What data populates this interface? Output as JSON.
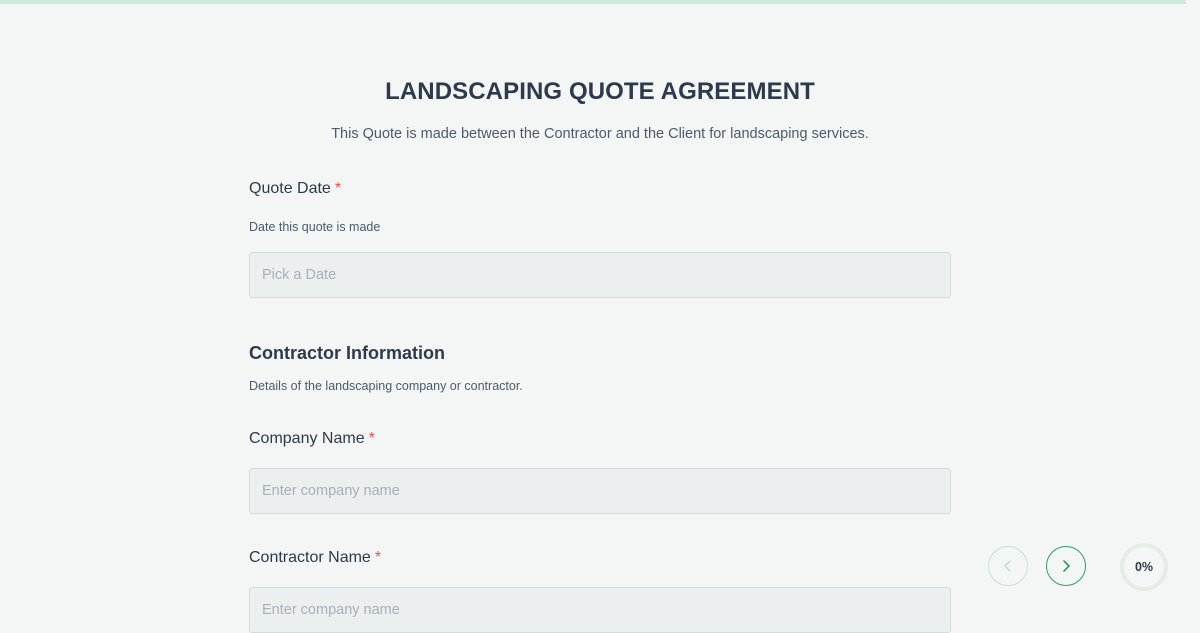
{
  "colors": {
    "accent": "#2f9e63",
    "accent_light": "#bfe3d0",
    "required": "#e5534b",
    "top_bar": "#cfeadb"
  },
  "form": {
    "title": "LANDSCAPING QUOTE AGREEMENT",
    "subtitle": "This Quote is made between the Contractor and the Client for landscaping services."
  },
  "fields": {
    "quote_date": {
      "label": "Quote Date",
      "required_mark": "*",
      "help": "Date this quote is made",
      "placeholder": "Pick a Date",
      "value": ""
    },
    "company_name": {
      "label": "Company Name",
      "required_mark": "*",
      "placeholder": "Enter company name",
      "value": ""
    },
    "contractor_name": {
      "label": "Contractor Name",
      "required_mark": "*",
      "placeholder": "Enter company name",
      "value": ""
    }
  },
  "sections": {
    "contractor_info": {
      "heading": "Contractor Information",
      "description": "Details of the landscaping company or contractor."
    }
  },
  "navigation": {
    "prev_icon": "chevron-left-icon",
    "next_icon": "chevron-right-icon",
    "progress_label": "0%",
    "progress_value": 0
  }
}
